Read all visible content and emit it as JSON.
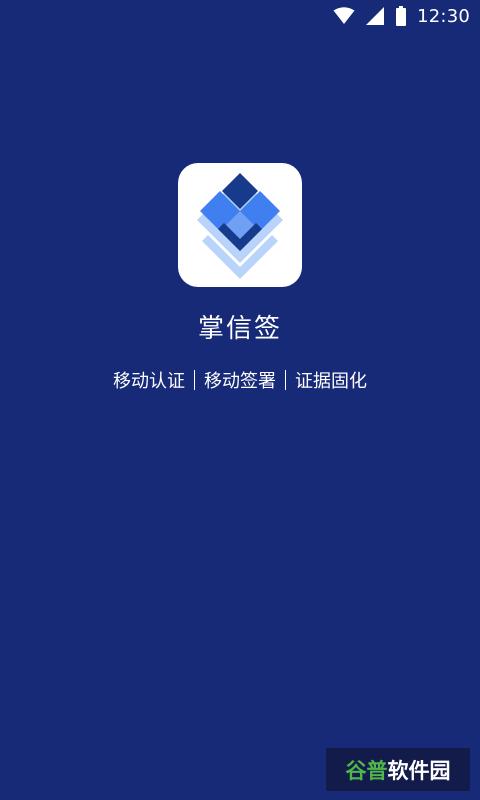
{
  "status_bar": {
    "time": "12:30",
    "icons": [
      "wifi-icon",
      "cellular-signal-icon",
      "battery-icon"
    ]
  },
  "app": {
    "name": "掌信签",
    "icon": "app-logo-icon",
    "slogan": [
      "移动认证",
      "移动签署",
      "证据固化"
    ]
  },
  "watermark": {
    "part1": "谷普",
    "part2": "软件园"
  },
  "colors": {
    "background": "#172a78",
    "logo_dark": "#173a8a",
    "logo_mid": "#3f7ff0",
    "logo_light": "#b9d3fb"
  }
}
